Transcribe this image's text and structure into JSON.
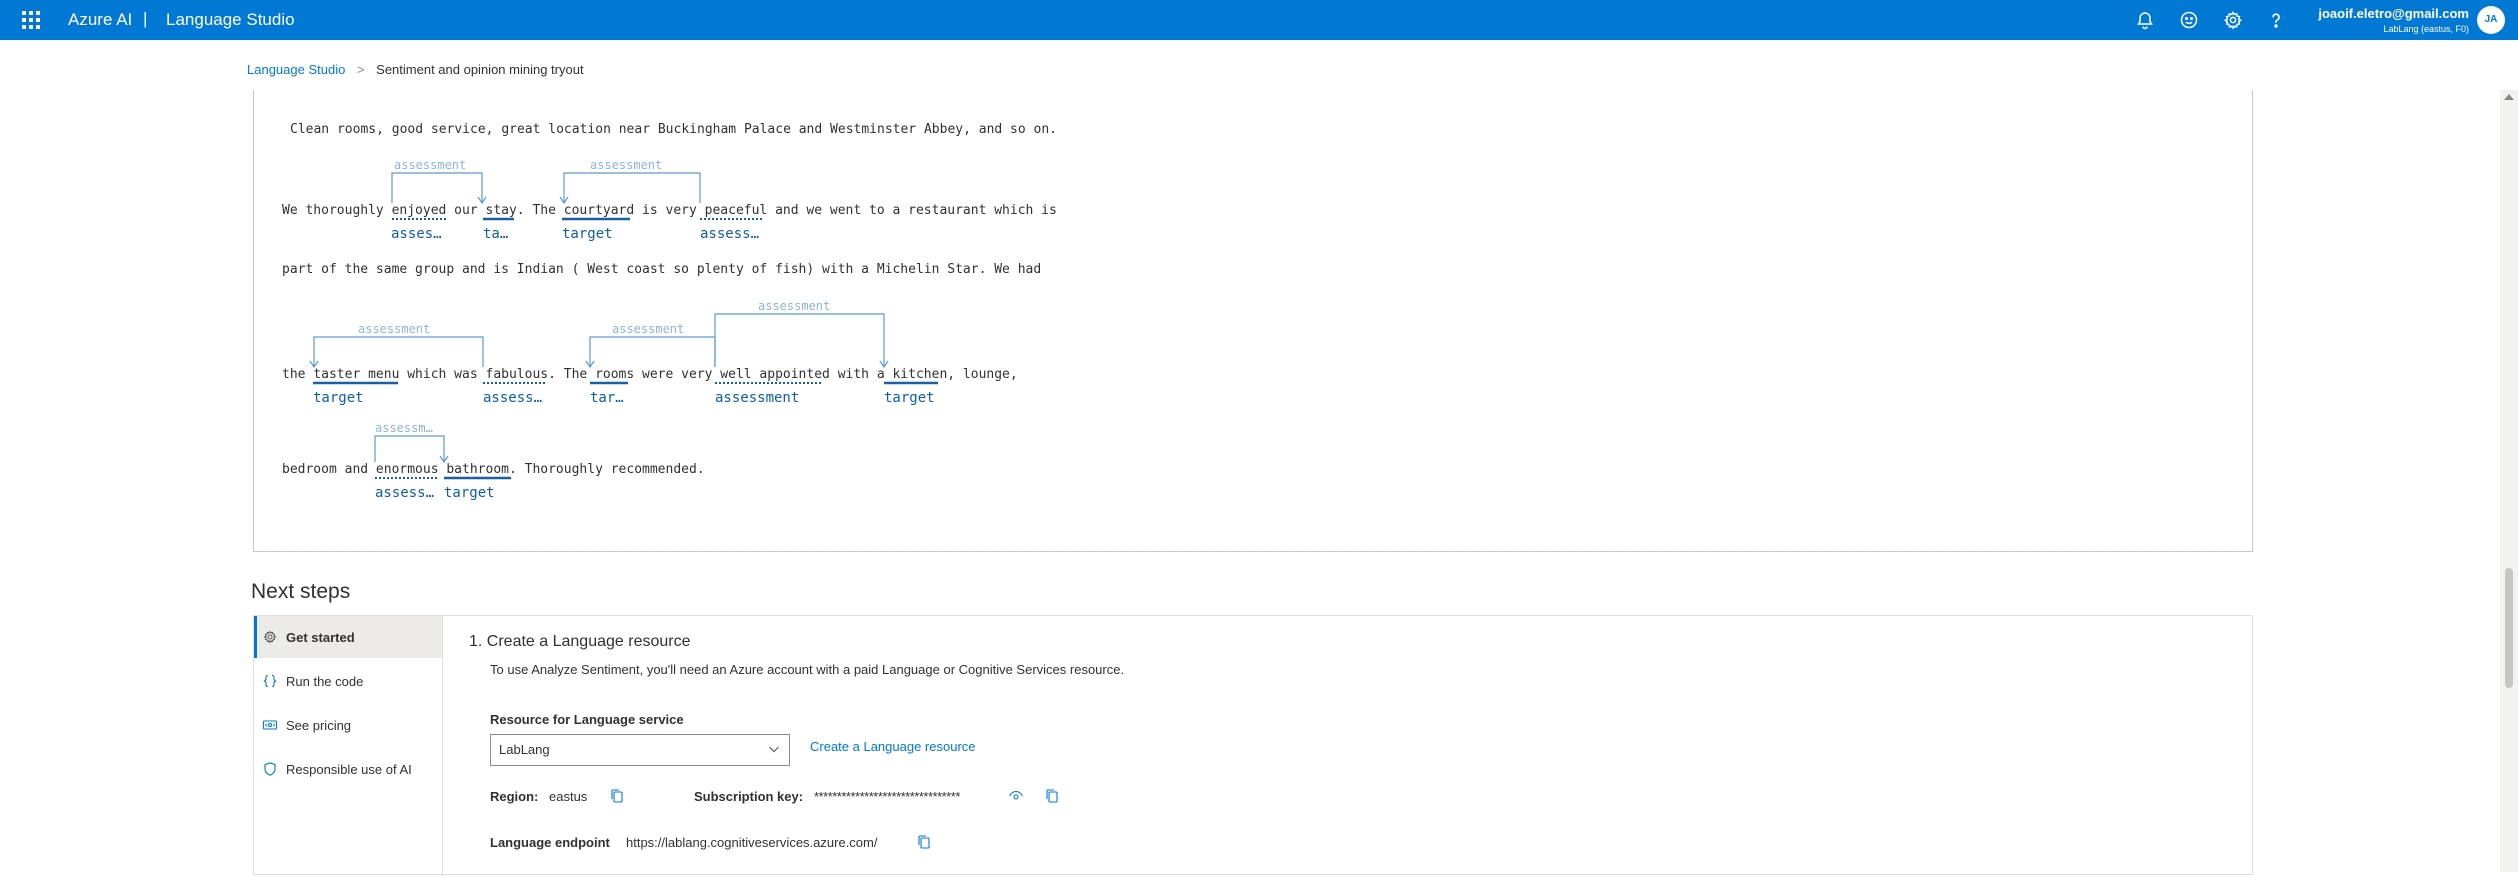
{
  "topbar": {
    "brand": "Azure AI",
    "separator": "|",
    "product": "Language Studio",
    "user_email": "joaoif.eletro@gmail.com",
    "user_sub": "LabLang (eastus, F0)",
    "avatar_initials": "JA",
    "icons": [
      "bell-icon",
      "smiley-icon",
      "gear-icon",
      "help-icon"
    ]
  },
  "breadcrumb": {
    "root": "Language Studio",
    "separator": ">",
    "current": "Sentiment and opinion mining tryout"
  },
  "result": {
    "lines": [
      "Clean rooms, good service, great location near Buckingham Palace and Westminster Abbey, and so on.",
      "We thoroughly enjoyed our stay. The courtyard is very peaceful and we went to a restaurant which is",
      "part of the same group and is Indian ( West coast so plenty of fish) with a Michelin Star. We had",
      "the taster menu which was fabulous. The rooms were very well appointed with a kitchen, lounge,",
      "bedroom and enormous bathroom. Thoroughly recommended."
    ],
    "arc_label": "assessment",
    "arc_label_truncated": "assessm…",
    "labels": {
      "assess_trunc": "asses…",
      "assess_trunc2": "assess…",
      "target": "target",
      "target_trunc_ta": "ta…",
      "target_trunc_tar": "tar…",
      "assessment": "assessment"
    }
  },
  "next_steps": {
    "title": "Next steps",
    "nav": [
      {
        "label": "Get started",
        "icon": "gear-icon",
        "active": true
      },
      {
        "label": "Run the code",
        "icon": "braces-icon",
        "active": false
      },
      {
        "label": "See pricing",
        "icon": "pricing-icon",
        "active": false
      },
      {
        "label": "Responsible use of AI",
        "icon": "shield-icon",
        "active": false
      }
    ],
    "step": {
      "title": "1. Create a Language resource",
      "description": "To use Analyze Sentiment, you'll need an Azure account with a paid Language or Cognitive Services resource.",
      "resource_label": "Resource for Language service",
      "resource_value": "LabLang",
      "create_link": "Create a Language resource",
      "region_label": "Region:",
      "region_value": "eastus",
      "key_label": "Subscription key:",
      "key_value": "********************************",
      "endpoint_label": "Language endpoint",
      "endpoint_value": "https://lablang.cognitiveservices.azure.com/"
    }
  },
  "colors": {
    "accent": "#0078d4",
    "label_blue": "#0f5ea8",
    "arc_blue": "#5b9bd5"
  }
}
